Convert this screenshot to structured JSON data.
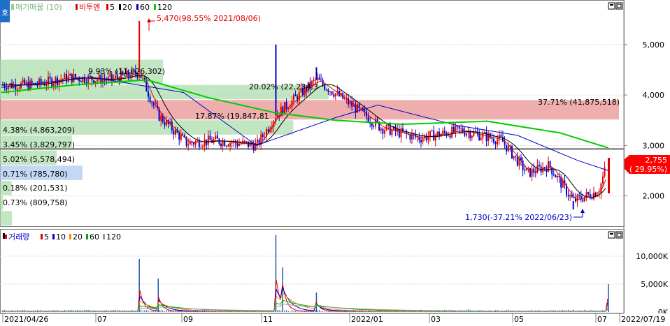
{
  "price_panel": {
    "legend": {
      "corner_tag": "호",
      "profile_label": "매기매물 (10)",
      "stock_name": "비투엔",
      "ma_labels": [
        "5",
        "20",
        "60",
        "120"
      ],
      "ma_colors": [
        "#e00000",
        "#000000",
        "#0000cc",
        "#00cc00"
      ]
    },
    "y_ticks": [
      "5,000",
      "4,000",
      "3,000",
      "2,000"
    ],
    "current_price": {
      "value": "2,755",
      "change": "( 29.95%)"
    },
    "high_annotation": "5,470(98.55% 2021/08/06)",
    "low_annotation": "1,730(-37.21% 2022/06/23)",
    "profile_labels": [
      "9.93% (11,026,302)",
      "20.02% (22,234,3",
      "37.71% (41,875,518)",
      "17.87% (19,847,81",
      "4.38% (4,863,209)",
      "3.45% (3,829,797)",
      "5.02% (5,578,494)",
      "0.71% (785,780)",
      "0.18% (201,531)",
      "0.73% (809,758)"
    ]
  },
  "volume_panel": {
    "legend": {
      "title": "거래량",
      "ma_labels": [
        "5",
        "10",
        "20",
        "60",
        "120"
      ],
      "ma_colors": [
        "#e00000",
        "#0000cc",
        "#ff8800",
        "#00aa00",
        "#999999"
      ]
    },
    "y_ticks": [
      "10,000K",
      "5,000K",
      "0K"
    ]
  },
  "x_axis": {
    "ticks": [
      "2021/04/26",
      "07",
      "09",
      "11",
      "2022/01",
      "03",
      "05",
      "07",
      "2022/07/19"
    ]
  },
  "chart_data": {
    "type": "candlestick",
    "title": "비투엔",
    "price_axis": {
      "range": [
        1400,
        5800
      ],
      "ticks": [
        5000,
        4000,
        3000,
        2000
      ]
    },
    "volume_axis": {
      "range": [
        0,
        14000
      ],
      "unit": "K",
      "ticks": [
        10000,
        5000,
        0
      ]
    },
    "date_range": [
      "2021/04/26",
      "2022/07/19"
    ],
    "price_path": [
      {
        "date": "2021/04/26",
        "close": 4200
      },
      {
        "date": "2021/05/20",
        "close": 4200
      },
      {
        "date": "2021/06/15",
        "close": 4350
      },
      {
        "date": "2021/07/15",
        "close": 4300
      },
      {
        "date": "2021/08/06",
        "close": 4450,
        "high": 5470
      },
      {
        "date": "2021/08/20",
        "close": 3600
      },
      {
        "date": "2021/09/10",
        "close": 3050
      },
      {
        "date": "2021/10/01",
        "close": 3100
      },
      {
        "date": "2021/11/01",
        "close": 3000
      },
      {
        "date": "2021/11/15",
        "close": 3600,
        "high": 5000
      },
      {
        "date": "2021/12/15",
        "close": 4300,
        "high": 4550
      },
      {
        "date": "2022/01/05",
        "close": 3900
      },
      {
        "date": "2022/02/01",
        "close": 3350
      },
      {
        "date": "2022/03/01",
        "close": 3150
      },
      {
        "date": "2022/04/01",
        "close": 3300
      },
      {
        "date": "2022/05/01",
        "close": 3100
      },
      {
        "date": "2022/05/20",
        "close": 2450
      },
      {
        "date": "2022/06/05",
        "close": 2600
      },
      {
        "date": "2022/06/23",
        "close": 1900,
        "low": 1730
      },
      {
        "date": "2022/07/12",
        "close": 2100
      },
      {
        "date": "2022/07/19",
        "close": 2755
      }
    ],
    "moving_averages": [
      {
        "name": "5",
        "color": "#e00000"
      },
      {
        "name": "20",
        "color": "#000000"
      },
      {
        "name": "60",
        "color": "#0000cc",
        "points": [
          [
            0,
            4150
          ],
          [
            0.15,
            4350
          ],
          [
            0.3,
            4050
          ],
          [
            0.42,
            3000
          ],
          [
            0.55,
            3550
          ],
          [
            0.62,
            3800
          ],
          [
            0.75,
            3400
          ],
          [
            0.85,
            3200
          ],
          [
            0.95,
            2700
          ],
          [
            1,
            2500
          ]
        ]
      },
      {
        "name": "120",
        "color": "#00cc00",
        "points": [
          [
            0,
            4050
          ],
          [
            0.12,
            4200
          ],
          [
            0.24,
            4300
          ],
          [
            0.34,
            3950
          ],
          [
            0.45,
            3650
          ],
          [
            0.55,
            3500
          ],
          [
            0.66,
            3420
          ],
          [
            0.8,
            3480
          ],
          [
            0.92,
            3250
          ],
          [
            1,
            2950
          ]
        ]
      }
    ],
    "horizontal_line": 2930,
    "volume_profile": [
      {
        "price_range": [
          4200,
          4700
        ],
        "pct": 9.93,
        "volume": 11026302,
        "color": "#a8dca8"
      },
      {
        "price_range": [
          3900,
          4200
        ],
        "pct": 20.02,
        "volume": 22234300,
        "color": "#a8dca8"
      },
      {
        "price_range": [
          3500,
          3900
        ],
        "pct": 37.71,
        "volume": 41875518,
        "color": "#e88c8c"
      },
      {
        "price_range": [
          3200,
          3500
        ],
        "pct": 17.87,
        "volume": 19847810,
        "color": "#a8dca8"
      },
      {
        "price_range": [
          2900,
          3200
        ],
        "pct": 4.38,
        "volume": 4863209,
        "color": "#a8dca8"
      },
      {
        "price_range": [
          2600,
          2900
        ],
        "pct": 3.45,
        "volume": 3829797,
        "color": "#a8dca8"
      },
      {
        "price_range": [
          2300,
          2600
        ],
        "pct": 5.02,
        "volume": 5578494,
        "color": "#a8c8f0"
      },
      {
        "price_range": [
          2000,
          2300
        ],
        "pct": 0.71,
        "volume": 785780,
        "color": "#a8dca8"
      },
      {
        "price_range": [
          1700,
          2000
        ],
        "pct": 0.18,
        "volume": 201531,
        "color": "#a8dca8"
      },
      {
        "price_range": [
          1400,
          1700
        ],
        "pct": 0.73,
        "volume": 809758,
        "color": "#a8dca8"
      }
    ],
    "volume_spikes": [
      {
        "date": "2021/08/06",
        "volume": 9500
      },
      {
        "date": "2021/08/20",
        "volume": 6000
      },
      {
        "date": "2021/11/15",
        "volume": 13800
      },
      {
        "date": "2021/11/20",
        "volume": 8000
      },
      {
        "date": "2021/12/15",
        "volume": 3500
      },
      {
        "date": "2022/07/19",
        "volume": 5000
      }
    ]
  }
}
